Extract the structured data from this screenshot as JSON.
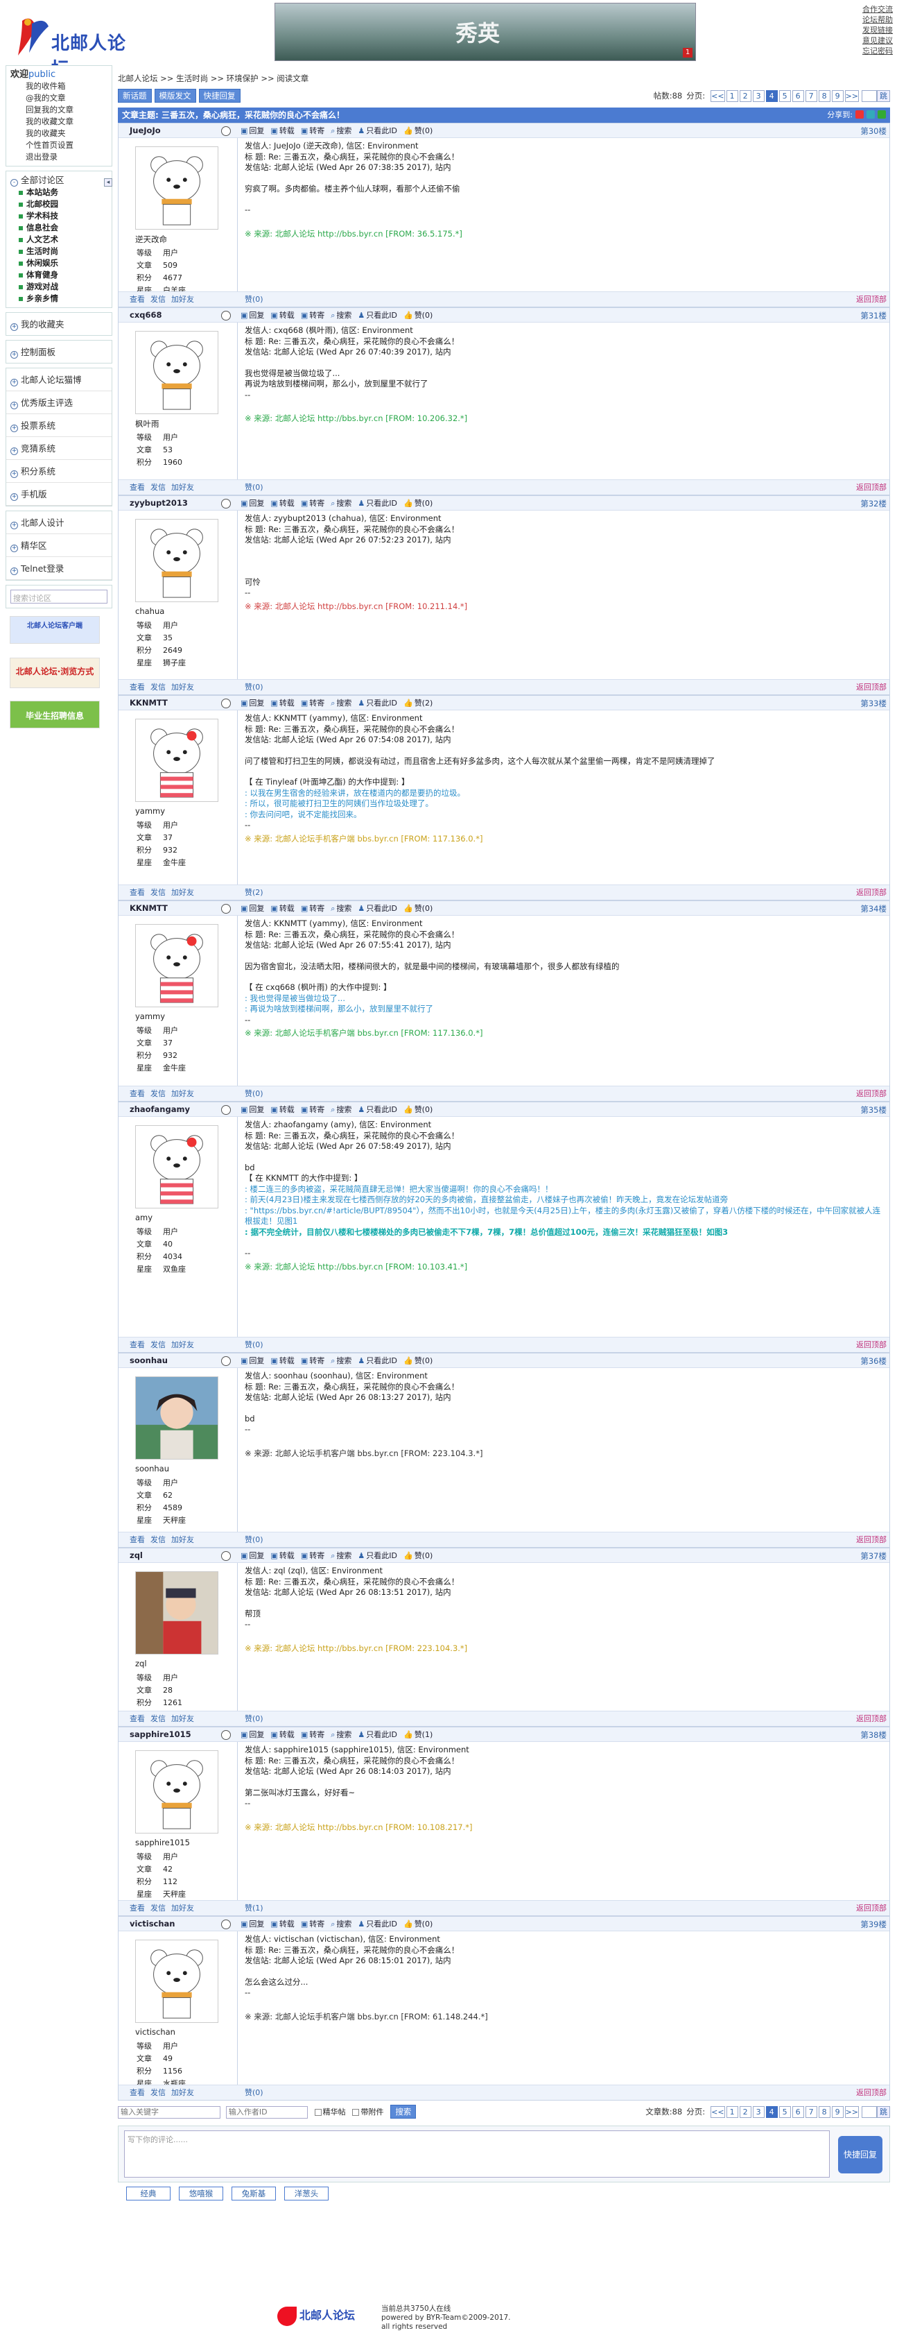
{
  "header": {
    "logo_text": "北邮人论坛",
    "banner_text": "秀英",
    "banner_close": "1",
    "links": [
      "合作交流",
      "论坛帮助",
      "发现链接",
      "意见建议",
      "忘记密码"
    ]
  },
  "sidebar": {
    "welcome": "欢迎",
    "user": "public",
    "user_links": [
      "我的收件箱",
      "@我的文章",
      "回复我的文章",
      "我的收藏文章",
      "我的收藏夹",
      "个性首页设置",
      "退出登录"
    ],
    "boards_title": "全部讨论区",
    "boards": [
      "本站站务",
      "北邮校园",
      "学术科技",
      "信息社会",
      "人文艺术",
      "生活时尚",
      "休闲娱乐",
      "体育健身",
      "游戏对战",
      "乡亲乡情"
    ],
    "fav": "我的收藏夹",
    "control": "控制面板",
    "group1": [
      "北邮人论坛猫博",
      "优秀版主评选",
      "投票系统",
      "竞猜系统",
      "积分系统",
      "手机版"
    ],
    "group2": [
      "北邮人设计",
      "精华区",
      "Telnet登录"
    ],
    "search_placeholder": "搜索讨论区",
    "ad1": "北邮人论坛客户端",
    "ad2": "北邮人论坛·浏览方式",
    "ad3": "毕业生招聘信息"
  },
  "main": {
    "crumbs": "北邮人论坛  >>  生活时尚  >>  环境保护  >>  阅读文章",
    "btn_new": "新话题",
    "btn_tmpl": "模版发文",
    "btn_quick": "快捷回复",
    "posts_count": "帖数:88",
    "page_label": "分页:",
    "pages": [
      "<<",
      "1",
      "2",
      "3",
      "4",
      "5",
      "6",
      "7",
      "8",
      "9",
      ">>"
    ],
    "current_page": "4",
    "go": "跳",
    "title": "文章主题: 三番五次，桑心病狂，采花贼你的良心不会痛么！",
    "share": "分享到:"
  },
  "actions": {
    "reply": "回复",
    "fwd": "转载",
    "repost": "转寄",
    "search": "搜索",
    "only": "只看此ID",
    "back_top": "返回顶部",
    "view": "查看",
    "msg": "发信",
    "addfriend": "加好友"
  },
  "posts": [
    {
      "user": "JueJoJo",
      "nick": "逆天改命",
      "level": "用户",
      "articles": "509",
      "points": "4677",
      "star": "白羊座",
      "floor": "第30楼",
      "zan": "赞(0)",
      "zan_top": "赞(0)",
      "lines": [
        "发信人: JueJoJo (逆天改命), 信区: Environment",
        "标  题: Re: 三番五次，桑心病狂，采花贼你的良心不会痛么！",
        "发信站: 北邮人论坛 (Wed Apr 26 07:38:35 2017), 站内",
        "",
        "穷疯了啊。多肉都偷。楼主养个仙人球啊，看那个人还偷不偷",
        "",
        "--",
        ""
      ],
      "src": "※ 来源: 北邮人论坛 http://bbs.byr.cn [FROM: 36.5.175.*]"
    },
    {
      "user": "cxq668",
      "nick": "枫叶雨",
      "level": "用户",
      "articles": "53",
      "points": "1960",
      "star": "",
      "floor": "第31楼",
      "zan": "赞(0)",
      "zan_top": "赞(0)",
      "lines": [
        "发信人: cxq668 (枫叶雨), 信区: Environment",
        "标  题: Re: 三番五次，桑心病狂，采花贼你的良心不会痛么！",
        "发信站: 北邮人论坛 (Wed Apr 26 07:40:39 2017), 站内",
        "",
        "我也觉得是被当做垃圾了...",
        "再说为啥放到楼梯间啊，那么小，放到屋里不就行了",
        "--",
        ""
      ],
      "src": "※ 来源: 北邮人论坛 http://bbs.byr.cn [FROM: 10.206.32.*]"
    },
    {
      "user": "zyybupt2013",
      "nick": "chahua",
      "level": "用户",
      "articles": "35",
      "points": "2649",
      "star": "狮子座",
      "floor": "第32楼",
      "zan": "赞(0)",
      "zan_top": "赞(0)",
      "lines": [
        "发信人: zyybupt2013 (chahua), 信区: Environment",
        "标  题: Re: 三番五次，桑心病狂，采花贼你的良心不会痛么！",
        "发信站: 北邮人论坛 (Wed Apr 26 07:52:23 2017), 站内",
        "",
        "",
        "",
        "可怜",
        "--"
      ],
      "src": "※ 来源: 北邮人论坛 http://bbs.byr.cn [FROM: 10.211.14.*]"
    },
    {
      "user": "KKNMTT",
      "nick": "yammy",
      "level": "用户",
      "articles": "37",
      "points": "932",
      "star": "金牛座",
      "floor": "第33楼",
      "zan": "赞(2)",
      "zan_top": "赞(2)",
      "lines": [
        "发信人: KKNMTT (yammy), 信区: Environment",
        "标  题: Re: 三番五次，桑心病狂，采花贼你的良心不会痛么！",
        "发信站: 北邮人论坛 (Wed Apr 26 07:54:08 2017), 站内",
        "",
        "问了楼管和打扫卫生的阿姨，都说没有动过，而且宿舍上还有好多盆多肉，这个人每次就从某个盆里偷一两棵，肯定不是阿姨清理掉了",
        "",
        "【 在 Tinyleaf (叶面坤乙酯) 的大作中提到: 】",
        ": 以我在男生宿舍的经验来讲，放在楼道内的都是要扔的垃圾。",
        ": 所以，很可能被打扫卫生的阿姨们当作垃圾处理了。",
        ": 你去问问吧，说不定能找回来。",
        "--"
      ],
      "src": "※ 来源: 北邮人论坛手机客户端 bbs.byr.cn [FROM: 117.136.0.*]"
    },
    {
      "user": "KKNMTT",
      "nick": "yammy",
      "level": "用户",
      "articles": "37",
      "points": "932",
      "star": "金牛座",
      "floor": "第34楼",
      "zan": "赞(0)",
      "zan_top": "赞(0)",
      "lines": [
        "发信人: KKNMTT (yammy), 信区: Environment",
        "标  题: Re: 三番五次，桑心病狂，采花贼你的良心不会痛么！",
        "发信站: 北邮人论坛 (Wed Apr 26 07:55:41 2017), 站内",
        "",
        "因为宿舍窗北，没法晒太阳，楼梯间很大的，就是最中间的楼梯间，有玻璃幕墙那个，很多人都放有绿植的",
        "",
        "【 在 cxq668 (枫叶雨) 的大作中提到: 】",
        ": 我也觉得是被当做垃圾了...",
        ": 再说为啥放到楼梯间啊，那么小，放到屋里不就行了",
        "--"
      ],
      "src": "※ 来源: 北邮人论坛手机客户端 bbs.byr.cn [FROM: 117.136.0.*]"
    },
    {
      "user": "zhaofangamy",
      "nick": "amy",
      "level": "用户",
      "articles": "40",
      "points": "4034",
      "star": "双鱼座",
      "floor": "第35楼",
      "zan": "赞(0)",
      "zan_top": "赞(0)",
      "lines": [
        "发信人: zhaofangamy (amy), 信区: Environment",
        "标  题: Re: 三番五次，桑心病狂，采花贼你的良心不会痛么！",
        "发信站: 北邮人论坛 (Wed Apr 26 07:58:49 2017), 站内",
        "",
        "bd",
        "【 在 KKNMTT 的大作中提到: 】",
        ": 楼二连三的多肉被盗，采花贼简直肆无忌惮！把大家当傻逼啊！你的良心不会痛吗！！",
        ": 前天(4月23日)楼主来发现在七楼西侧存放的好20天的多肉被偷，直接整盆偷走，八楼妹子也再次被偷！昨天晚上，竟发在论坛发帖道旁",
        ": \"https://bbs.byr.cn/#!article/BUPT/89504\"），然而不出10小时，也就是今天(4月25日)上午，楼主的多肉(永灯玉露)又被偷了，穿着八仿楼下楼的时候还在，中午回家就被人连根拔走！见图1",
        ": 据不完全统计，目前仅八楼和七楼楼梯处的多肉已被偷走不下7棵，7棵，7棵！总价值超过100元，连偷三次！采花贼猖狂至极！如图3",
        "",
        "--"
      ],
      "src": "※ 来源: 北邮人论坛 http://bbs.byr.cn [FROM: 10.103.41.*]"
    },
    {
      "user": "soonhau",
      "nick": "soonhau",
      "level": "用户",
      "articles": "62",
      "points": "4589",
      "star": "天秤座",
      "floor": "第36楼",
      "zan": "赞(0)",
      "zan_top": "赞(0)",
      "lines": [
        "发信人: soonhau (soonhau), 信区: Environment",
        "标  题: Re: 三番五次，桑心病狂，采花贼你的良心不会痛么！",
        "发信站: 北邮人论坛 (Wed Apr 26 08:13:27 2017), 站内",
        "",
        "bd",
        "--",
        ""
      ],
      "src": "※ 来源: 北邮人论坛手机客户端 bbs.byr.cn [FROM: 223.104.3.*]"
    },
    {
      "user": "zql",
      "nick": "zql",
      "level": "用户",
      "articles": "28",
      "points": "1261",
      "star": "",
      "floor": "第37楼",
      "zan": "赞(0)",
      "zan_top": "赞(0)",
      "lines": [
        "发信人: zql (zql), 信区: Environment",
        "标  题: Re: 三番五次，桑心病狂，采花贼你的良心不会痛么！",
        "发信站: 北邮人论坛 (Wed Apr 26 08:13:51 2017), 站内",
        "",
        "帮顶",
        "--",
        ""
      ],
      "src": "※ 来源: 北邮人论坛 http://bbs.byr.cn [FROM: 223.104.3.*]"
    },
    {
      "user": "sapphire1015",
      "nick": "sapphire1015",
      "level": "用户",
      "articles": "42",
      "points": "112",
      "star": "天秤座",
      "floor": "第38楼",
      "zan": "赞(1)",
      "zan_top": "赞(1)",
      "lines": [
        "发信人: sapphire1015 (sapphire1015), 信区: Environment",
        "标  题: Re: 三番五次，桑心病狂，采花贼你的良心不会痛么！",
        "发信站: 北邮人论坛 (Wed Apr 26 08:14:03 2017), 站内",
        "",
        "第二张叫冰灯玉露么，好好看~",
        "--",
        ""
      ],
      "src": "※ 来源: 北邮人论坛 http://bbs.byr.cn [FROM: 10.108.217.*]"
    },
    {
      "user": "victischan",
      "nick": "victischan",
      "level": "用户",
      "articles": "49",
      "points": "1156",
      "star": "水瓶座",
      "floor": "第39楼",
      "zan": "赞(0)",
      "zan_top": "赞(0)",
      "lines": [
        "发信人: victischan (victischan), 信区: Environment",
        "标  题: Re: 三番五次，桑心病狂，采花贼你的良心不会痛么！",
        "发信站: 北邮人论坛 (Wed Apr 26 08:15:01 2017), 站内",
        "",
        "怎么会这么过分...",
        "--",
        ""
      ],
      "src": "※ 来源: 北邮人论坛手机客户端 bbs.byr.cn [FROM: 61.148.244.*]"
    }
  ],
  "bottom": {
    "kw_placeholder": "输入关键字",
    "author_placeholder": "输入作者ID",
    "digest": "精华帖",
    "attach": "带附件",
    "search_btn": "搜索",
    "articles_count": "文章数:88",
    "reply_placeholder": "写下你的评论......",
    "send": "快捷回复",
    "tabs": [
      "经典",
      "悠嘻猴",
      "兔斯基",
      "洋葱头"
    ]
  },
  "footer": {
    "logo": "北邮人论坛",
    "online": "当前总共3750人在线",
    "powered": "powered by BYR-Team©2009-2017.",
    "rights": "all rights reserved"
  }
}
